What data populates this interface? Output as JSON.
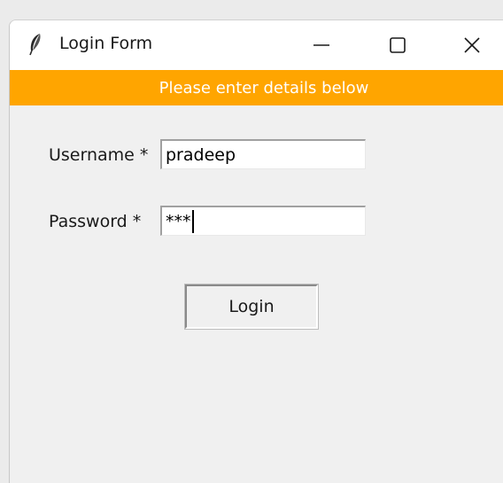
{
  "window": {
    "title": "Login Form",
    "icon": "feather-icon",
    "controls": {
      "minimize": "minimize-icon",
      "maximize": "maximize-icon",
      "close": "close-icon"
    }
  },
  "banner": {
    "text": "Please enter details below",
    "background": "#ffa500",
    "color": "#ffffff"
  },
  "form": {
    "username_label": "Username *",
    "username_value": "pradeep",
    "password_label": "Password *",
    "password_value": "***",
    "login_label": "Login"
  }
}
